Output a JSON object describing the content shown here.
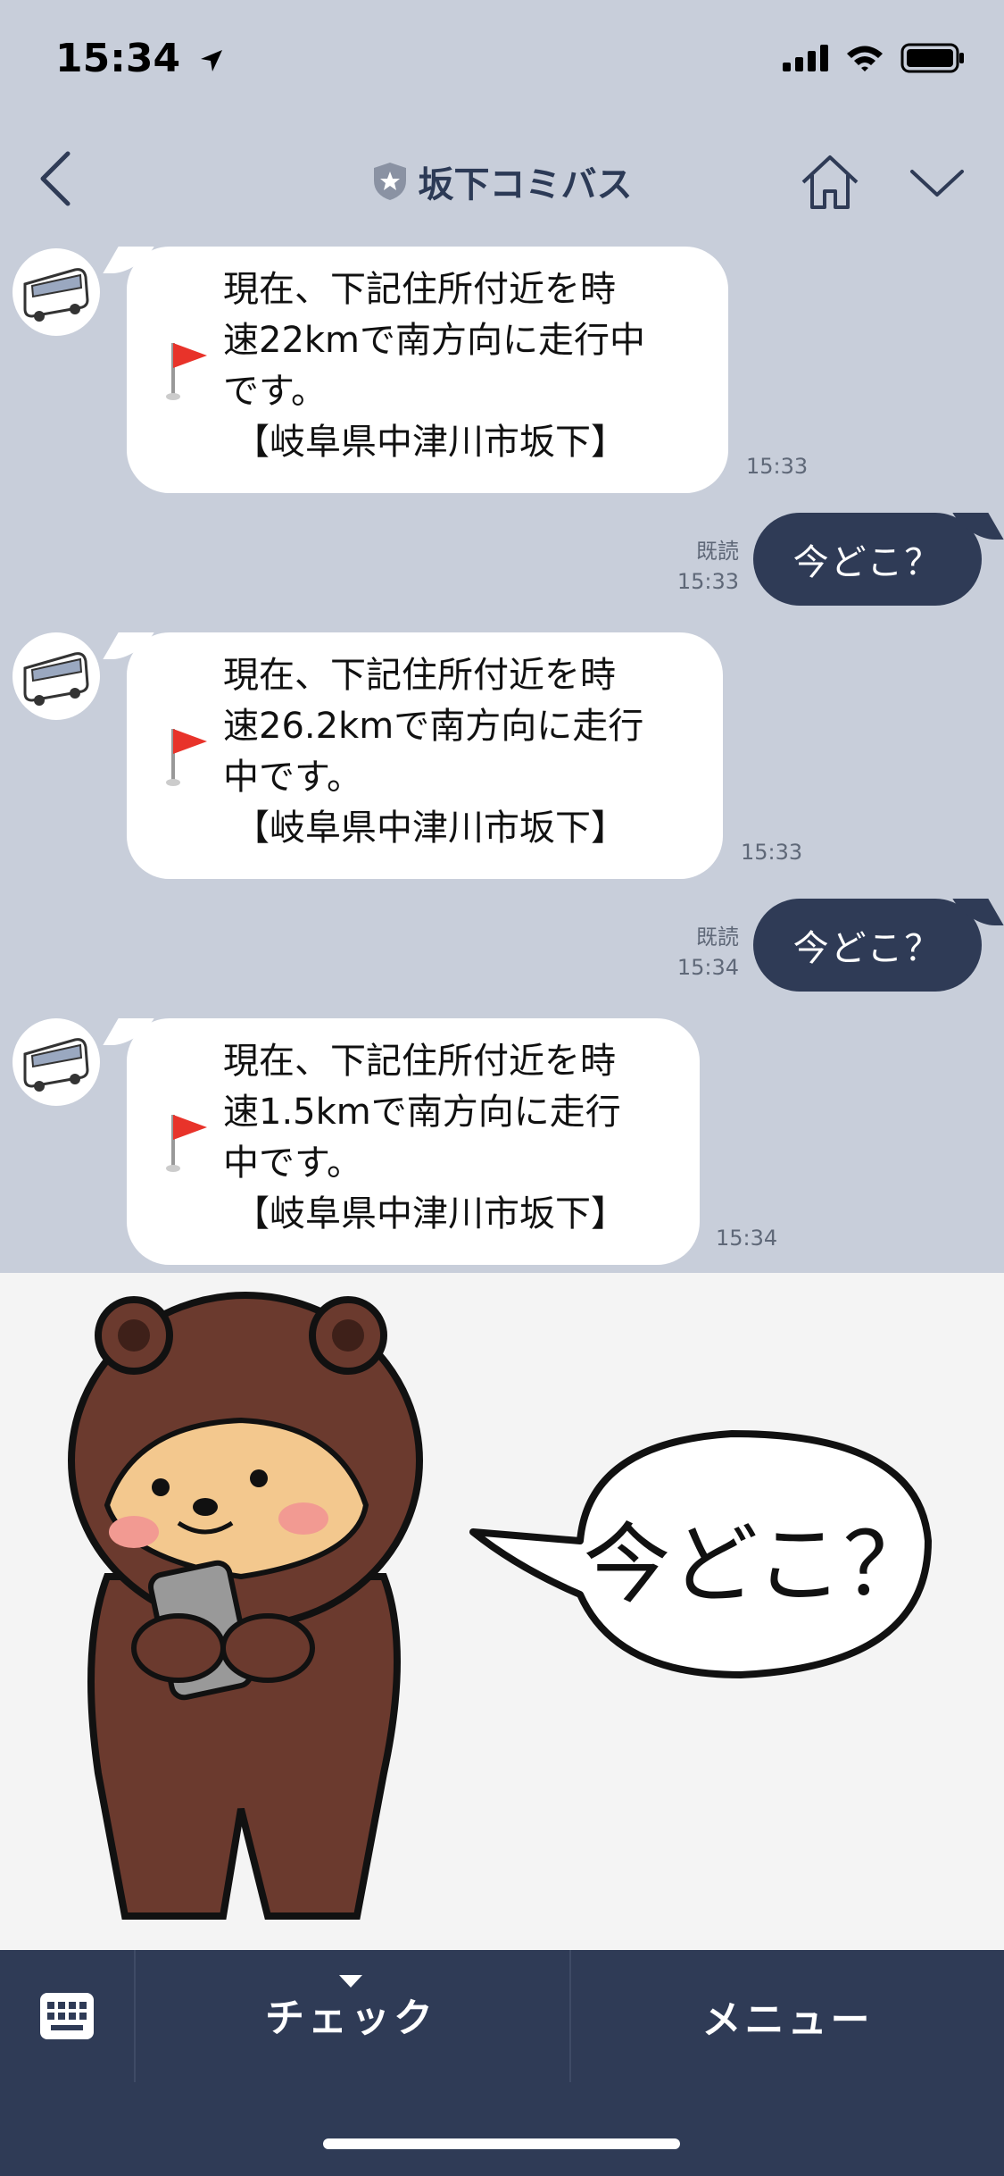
{
  "status_bar": {
    "time": "15:34"
  },
  "header": {
    "title": "坂下コミバス"
  },
  "messages": [
    {
      "type": "incoming",
      "lines": [
        "現在、下記住所付近を時",
        "速22kmで南方向に走行中",
        "です。",
        "【岐阜県中津川市坂下】"
      ],
      "time": "15:33"
    },
    {
      "type": "outgoing",
      "text": "今どこ？",
      "read": "既読",
      "time": "15:33"
    },
    {
      "type": "incoming",
      "lines": [
        "現在、下記住所付近を時",
        "速26.2kmで南方向に走行",
        "中です。",
        "【岐阜県中津川市坂下】"
      ],
      "time": "15:33"
    },
    {
      "type": "outgoing",
      "text": "今どこ？",
      "read": "既読",
      "time": "15:34"
    },
    {
      "type": "incoming",
      "lines": [
        "現在、下記住所付近を時",
        "速1.5kmで南方向に走行",
        "中です。",
        "【岐阜県中津川市坂下】"
      ],
      "time": "15:34"
    }
  ],
  "rich_menu": {
    "speech_text": "今どこ？"
  },
  "tab_bar": {
    "check_label": "チェック",
    "menu_label": "メニュー"
  }
}
